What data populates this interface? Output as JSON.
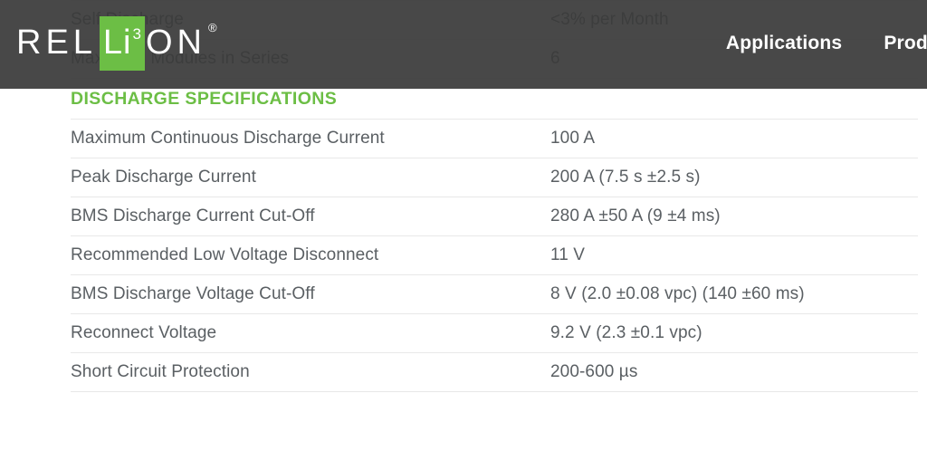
{
  "header": {
    "logo": {
      "part1": "REL",
      "part_green": "Li",
      "superscript": "3",
      "part2": "ON",
      "registered": "®"
    },
    "nav": [
      {
        "label": "Applications"
      },
      {
        "label": "Produ"
      }
    ]
  },
  "spec_sheet": {
    "scrolled_rows": [
      {
        "label": "Self Discharge",
        "value": "<3% per Month"
      },
      {
        "label": "Maximum Modules in Series",
        "value": "6"
      }
    ],
    "section_title": "DISCHARGE SPECIFICATIONS",
    "rows": [
      {
        "label": "Maximum Continuous Discharge Current",
        "value": "100 A"
      },
      {
        "label": "Peak Discharge Current",
        "value": "200 A (7.5 s ±2.5 s)"
      },
      {
        "label": "BMS Discharge Current Cut-Off",
        "value": "280 A ±50 A (9 ±4 ms)"
      },
      {
        "label": "Recommended Low Voltage Disconnect",
        "value": "11 V"
      },
      {
        "label": "BMS Discharge Voltage Cut-Off",
        "value": "8 V (2.0 ±0.08 vpc) (140 ±60 ms)"
      },
      {
        "label": "Reconnect Voltage",
        "value": "9.2 V (2.3 ±0.1 vpc)"
      },
      {
        "label": "Short Circuit Protection",
        "value": "200-600 µs"
      }
    ]
  },
  "theme": {
    "brand_green": "#6cbe45",
    "header_bg": "#3a3a3a",
    "text_color": "#5a5f63",
    "rule_color": "#e8e8e8"
  }
}
